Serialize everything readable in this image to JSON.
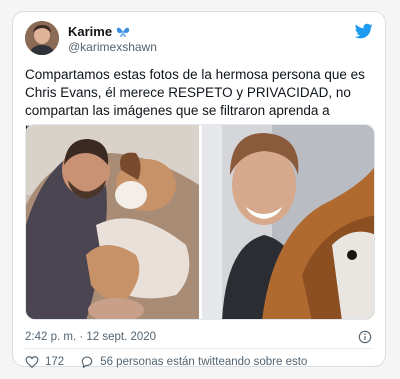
{
  "user": {
    "display_name": "Karime",
    "name_emoji": "butterfly-icon",
    "handle": "@karimexshawn"
  },
  "tweet": {
    "text": "Compartamos estas fotos de la hermosa persona que es Chris Evans, él merece RESPETO y PRIVACIDAD, no compartan las imágenes que se filtraron aprenda a respetar.",
    "timestamp": "2:42 p. m. · 12 sept. 2020"
  },
  "actions": {
    "likes": "172",
    "conversation_text": "56 personas están twitteando sobre esto"
  },
  "colors": {
    "twitter_blue": "#1d9bf0",
    "text": "#0f1419",
    "muted": "#536471"
  }
}
